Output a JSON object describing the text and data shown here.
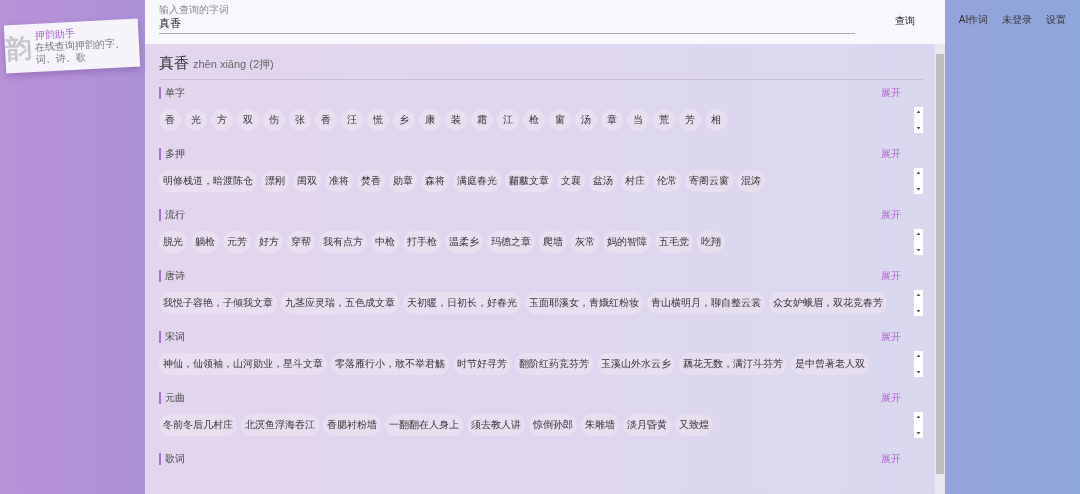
{
  "sidebar": {
    "logo_glyph": "韵",
    "title": "押韵助手",
    "subtitle": "在线查询押韵的字、词、诗、歌"
  },
  "search": {
    "label": "输入查询的字词",
    "value": "真香",
    "button": "查询"
  },
  "nav": [
    {
      "label": "AI作词"
    },
    {
      "label": "未登录"
    },
    {
      "label": "设置"
    }
  ],
  "result": {
    "word": "真香",
    "pinyin": "zhēn xiāng",
    "rhyme_count": "(2押)"
  },
  "sections": [
    {
      "title": "单字",
      "expand": "展开",
      "items": [
        "香",
        "光",
        "方",
        "双",
        "伤",
        "张",
        "香",
        "汪",
        "慌",
        "乡",
        "康",
        "装",
        "霜",
        "江",
        "枪",
        "窗",
        "汤",
        "章",
        "当",
        "荒",
        "芳",
        "相"
      ]
    },
    {
      "title": "多押",
      "expand": "展开",
      "items": [
        "明修栈道，暗渡陈仓",
        "漂刚",
        "闺双",
        "准将",
        "焚香",
        "勋章",
        "森将",
        "满庭春光",
        "黼黻文章",
        "文襄",
        "盆汤",
        "村庄",
        "伦常",
        "寄阁云窗",
        "混涛"
      ]
    },
    {
      "title": "流行",
      "expand": "展开",
      "items": [
        "脱光",
        "躺枪",
        "元芳",
        "好方",
        "穿帮",
        "我有点方",
        "中枪",
        "打手枪",
        "温柔乡",
        "玛德之章",
        "爬墙",
        "灰常",
        "妈的智障",
        "五毛党",
        "吃翔"
      ]
    },
    {
      "title": "唐诗",
      "expand": "展开",
      "items": [
        "我悦子容艳，子倾我文章",
        "九茎应灵瑞，五色成文章",
        "天初暖，日初长，好春光",
        "玉面耶溪女，青娥红粉妆",
        "青山横明月，聊自整云裳",
        "众女妒蛾眉，双花竞春芳"
      ]
    },
    {
      "title": "宋词",
      "expand": "展开",
      "items": [
        "神仙，仙领袖，山河勋业，星斗文章",
        "零落雁行小，敢不举君觞",
        "时节好寻芳",
        "翻阶红药竞芬芳",
        "玉溪山外水云乡",
        "藕花无数，满汀斗芬芳",
        "是中曾著老人双"
      ]
    },
    {
      "title": "元曲",
      "expand": "展开",
      "items": [
        "冬前冬后几村庄",
        "北溟鱼浮海吞江",
        "香腮衬粉墙",
        "一翻翻在人身上",
        "须去教人讲",
        "惊倒孙郎",
        "朱雕墙",
        "淡月昏黄",
        "又致煌"
      ]
    },
    {
      "title": "歌词",
      "expand": "展开"
    }
  ]
}
